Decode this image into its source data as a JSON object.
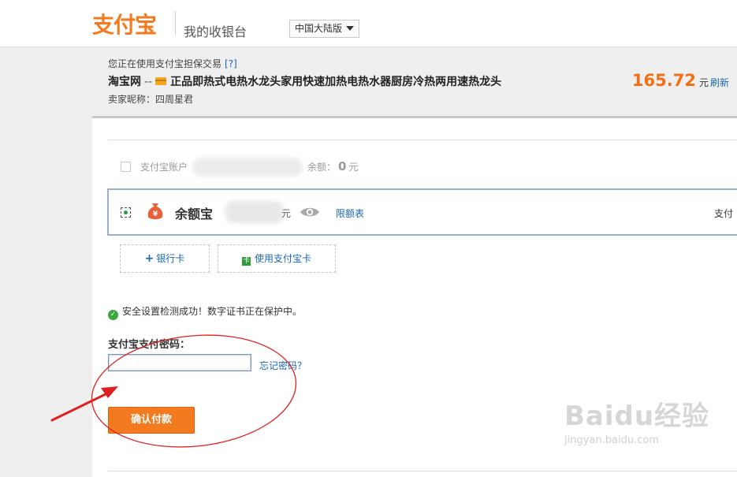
{
  "header": {
    "logo": "支付宝",
    "title": "我的收银台",
    "region": "中国大陆版"
  },
  "order": {
    "note": "您正在使用支付宝担保交易",
    "note_help": "[?]",
    "site": "淘宝网",
    "separator": "--",
    "product": "正品即热式电热水龙头家用快速加热电热水器厨房冷热两用速热龙头",
    "seller": "卖家昵称：四周星君",
    "amount": "165.72",
    "currency": "元",
    "refresh": "刷新"
  },
  "payment": {
    "account_label": "支付宝账户",
    "balance_label": "余额：",
    "balance_value": "0",
    "balance_unit": "元",
    "yuebao_name": "余额宝",
    "yuebao_unit": "元",
    "limit_link": "限额表",
    "pay_label": "支付",
    "bank_card_button": "银行卡",
    "bank_card_plus": "+",
    "alipay_card_button": "使用支付宝卡"
  },
  "security": {
    "message": "安全设置检测成功！数字证书正在保护中。"
  },
  "password": {
    "label": "支付宝支付密码：",
    "value": "",
    "forgot": "忘记密码？"
  },
  "confirm_button": "确认付款",
  "watermark": {
    "main": "Baidu经验",
    "sub": "jingyan.baidu.com"
  },
  "colors": {
    "brand_orange": "#f47a20",
    "amount_orange": "#f36e14",
    "link_blue": "#1a66b3",
    "annotation_red": "#e02020",
    "selected_border": "#9aaecf"
  }
}
